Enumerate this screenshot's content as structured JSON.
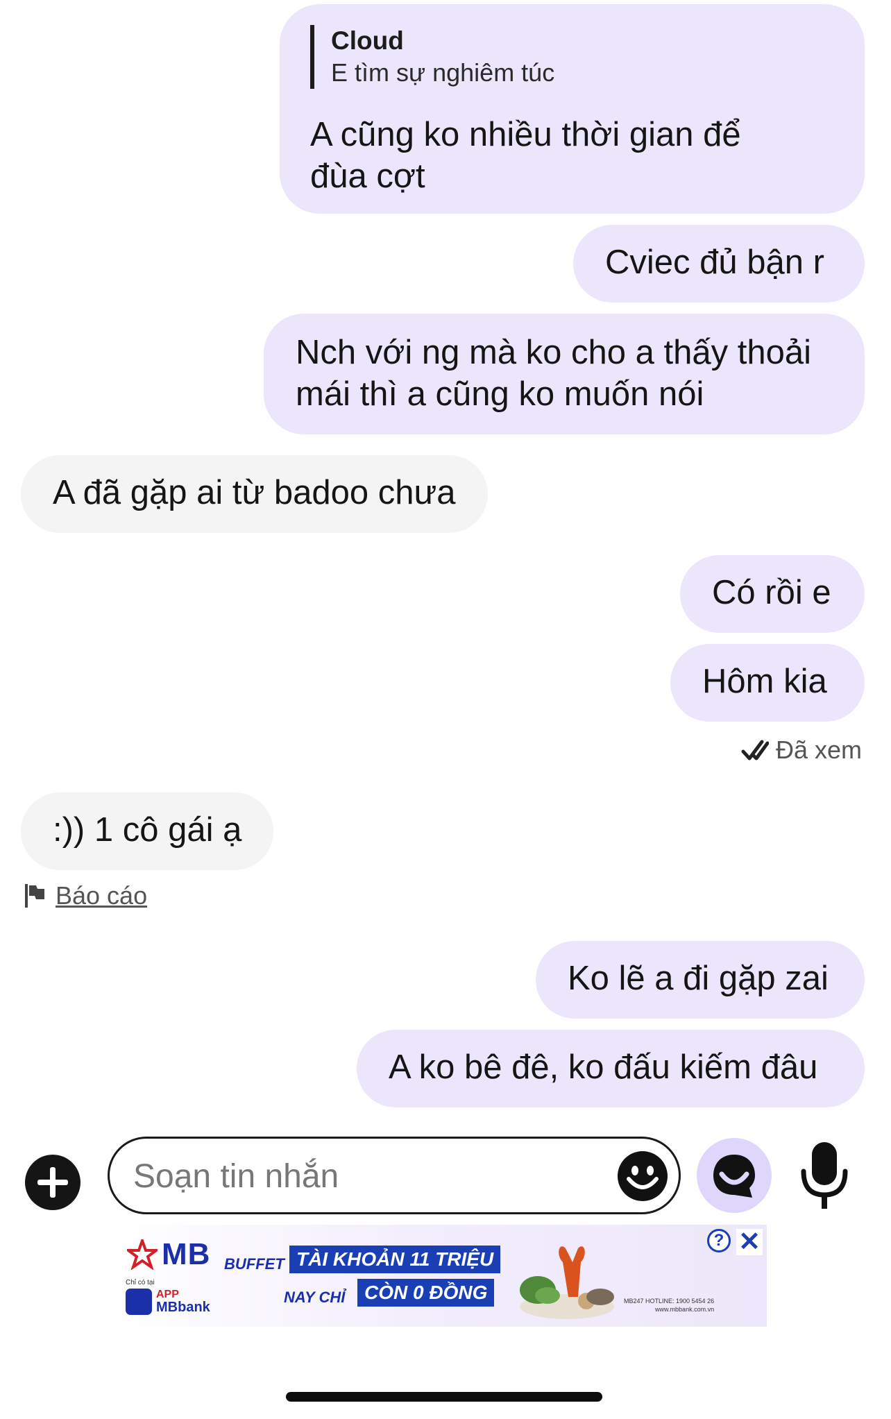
{
  "messages": [
    {
      "direction": "out",
      "reply_to": {
        "name": "Cloud",
        "text": "E tìm sự nghiêm túc"
      },
      "lines": [
        "A cũng ko nhiều thời gian để",
        "đùa cợt"
      ]
    },
    {
      "direction": "out",
      "lines": [
        "Cviec đủ bận r"
      ]
    },
    {
      "direction": "out",
      "lines": [
        "Nch với ng mà ko cho a thấy thoải",
        "mái thì a cũng ko muốn nói"
      ]
    },
    {
      "direction": "in",
      "lines": [
        "A đã gặp ai từ badoo chưa"
      ]
    },
    {
      "direction": "out",
      "lines": [
        "Có rồi e"
      ]
    },
    {
      "direction": "out",
      "lines": [
        "Hôm kia"
      ]
    },
    {
      "direction": "in",
      "lines": [
        ":)) 1 cô gái ạ"
      ]
    },
    {
      "direction": "out",
      "lines": [
        "Ko lẽ a đi gặp zai"
      ]
    },
    {
      "direction": "out",
      "lines": [
        "A ko bê đê, ko đấu kiếm đâu"
      ]
    }
  ],
  "seen_label": "Đã xem",
  "report_label": "Báo cáo",
  "composer": {
    "placeholder": "Soạn tin nhắn"
  },
  "icons": {
    "plus": "plus-circle-icon",
    "emoji": "smiley-icon",
    "chat": "chat-bubble-smile-icon",
    "mic": "microphone-icon",
    "seen": "double-check-icon",
    "report": "flag-icon"
  },
  "ad": {
    "brand": "MB",
    "app_small": "Chỉ có tại",
    "app_line1": "APP",
    "app_line2": "MBbank",
    "buffet": "BUFFET",
    "headline": "TÀI KHOẢN 11 TRIỆU",
    "naychi": "NAY CHỈ",
    "subline": "CÒN 0 ĐỒNG",
    "hotline": "MB247 HOTLINE: 1900 5454 26",
    "website": "www.mbbank.com.vn"
  },
  "colors": {
    "outgoing_bubble": "#ebe6fb",
    "incoming_bubble": "#f4f4f4",
    "accent": "#ded6fb",
    "ad_blue": "#1a3fb5"
  }
}
